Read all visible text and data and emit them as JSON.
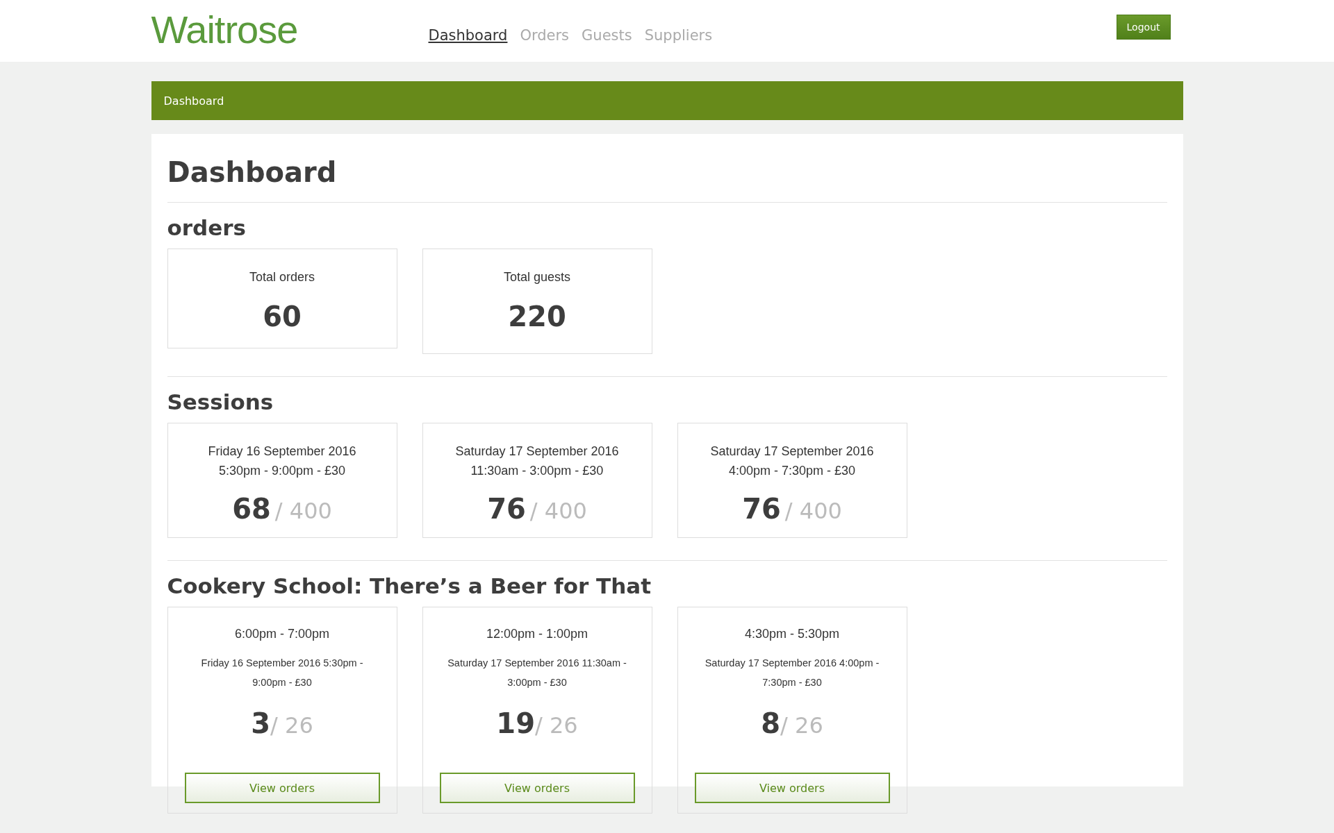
{
  "header": {
    "logo": "Waitrose",
    "nav": [
      {
        "label": "Dashboard",
        "selected": true
      },
      {
        "label": "Orders",
        "selected": false
      },
      {
        "label": "Guests",
        "selected": false
      },
      {
        "label": "Suppliers",
        "selected": false
      }
    ],
    "logout": "Logout"
  },
  "breadcrumb": "Dashboard",
  "title": "Dashboard",
  "sections": [
    {
      "heading": "orders",
      "kind": "stat",
      "cards": [
        {
          "label": "Total orders",
          "value": "60"
        },
        {
          "label": "Total guests",
          "value": "220"
        }
      ]
    },
    {
      "heading": "Sessions",
      "kind": "session",
      "cards": [
        {
          "date": "Friday 16 September 2016",
          "time": "5:30pm - 9:00pm - £30",
          "count": "68",
          "total": "/ 400"
        },
        {
          "date": "Saturday 17 September 2016",
          "time": "11:30am - 3:00pm - £30",
          "count": "76",
          "total": "/ 400"
        },
        {
          "date": "Saturday 17 September 2016",
          "time": "4:00pm - 7:30pm - £30",
          "count": "76",
          "total": "/ 400"
        }
      ]
    },
    {
      "heading": "Cookery School: There’s a Beer for That",
      "kind": "class",
      "cards": [
        {
          "time": "6:00pm - 7:00pm",
          "session": "Friday 16 September 2016 5:30pm - 9:00pm - £30",
          "count": "3",
          "total": "/ 26",
          "button": "View orders"
        },
        {
          "time": "12:00pm - 1:00pm",
          "session": "Saturday 17 September 2016 11:30am - 3:00pm - £30",
          "count": "19",
          "total": "/ 26",
          "button": "View orders"
        },
        {
          "time": "4:30pm - 5:30pm",
          "session": "Saturday 17 September 2016 4:00pm - 7:30pm - £30",
          "count": "8",
          "total": "/ 26",
          "button": "View orders"
        }
      ]
    }
  ]
}
